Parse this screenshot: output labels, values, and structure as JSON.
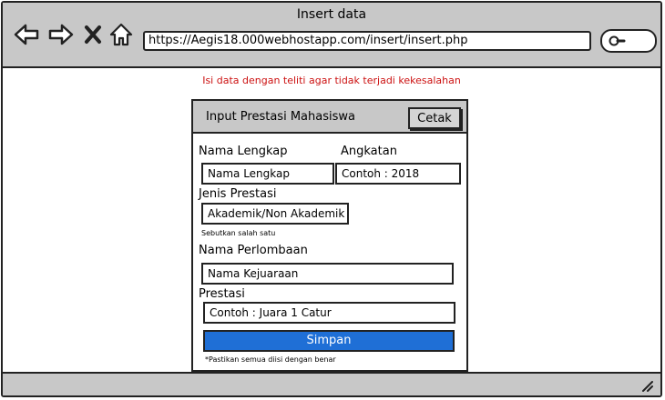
{
  "window": {
    "title": "Insert data",
    "url": "https://Aegis18.000webhostapp.com/insert/insert.php"
  },
  "nav_icons": [
    "back-arrow-icon",
    "forward-arrow-icon",
    "close-icon",
    "home-icon",
    "search-icon"
  ],
  "warning_text": "Isi data dengan teliti agar tidak terjadi kekesalahan",
  "form": {
    "title": "Input Prestasi Mahasiswa",
    "print_label": "Cetak",
    "name_label": "Nama Lengkap",
    "name_placeholder": "Nama Lengkap",
    "year_label": "Angkatan",
    "year_placeholder": "Contoh : 2018",
    "type_label": "Jenis Prestasi",
    "type_placeholder": "Akademik/Non Akademik",
    "type_hint": "Sebutkan salah satu",
    "competition_label": "Nama Perlombaan",
    "competition_placeholder": "Nama Kejuaraan",
    "achievement_label": "Prestasi",
    "achievement_placeholder": "Contoh : Juara 1 Catur",
    "submit_label": "Simpan",
    "footnote": "*Pastikan semua diisi dengan benar"
  },
  "colors": {
    "warning": "#cc1111",
    "submit": "#1f6fd6",
    "chrome": "#c8c8c8"
  }
}
